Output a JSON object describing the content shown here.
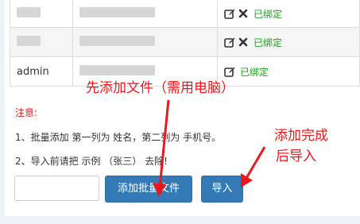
{
  "table": {
    "rows": [
      {
        "name": "",
        "status": "已绑定",
        "show_delete": true
      },
      {
        "name": "",
        "status": "已绑定",
        "show_delete": true
      },
      {
        "name": "admin",
        "status": "已绑定",
        "show_delete": false
      }
    ]
  },
  "notes": {
    "title": "注意:",
    "line1": "1、批量添加 第一列为 姓名，第二列为 手机号。",
    "line2": "2、导入前请把 示例 （张三） 去除!"
  },
  "buttons": {
    "batch_add": "添加批量文件",
    "import": "导入"
  },
  "annotations": {
    "first": "先添加文件（需用电脑）",
    "second_line1": "添加完成",
    "second_line2": "后导入"
  },
  "colors": {
    "annotation": "#e8191c",
    "status": "#1aa31a",
    "button": "#337ab7",
    "note_title": "#e02020"
  },
  "icons": [
    "edit-icon",
    "delete-x-icon"
  ]
}
